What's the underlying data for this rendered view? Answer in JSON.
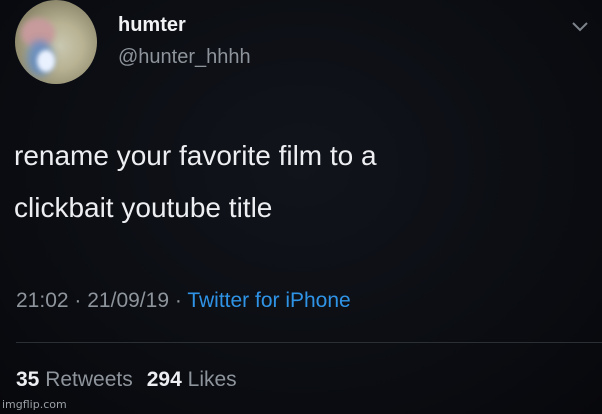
{
  "user": {
    "display_name": "humter",
    "handle": "@hunter_hhhh"
  },
  "icons": {
    "menu": "chevron-down-icon"
  },
  "tweet": {
    "text_line1": "rename your favorite film to a",
    "text_line2": "clickbait youtube title"
  },
  "meta": {
    "time": "21:02",
    "separator": "·",
    "date": "21/09/19",
    "source": "Twitter for iPhone"
  },
  "stats": {
    "retweets_count": "35",
    "retweets_label": "Retweets",
    "likes_count": "294",
    "likes_label": "Likes"
  },
  "watermark": "imgflip.com",
  "colors": {
    "background": "#0a0c11",
    "text": "#eceef1",
    "secondary": "#8e949b",
    "link": "#2f93e6"
  }
}
